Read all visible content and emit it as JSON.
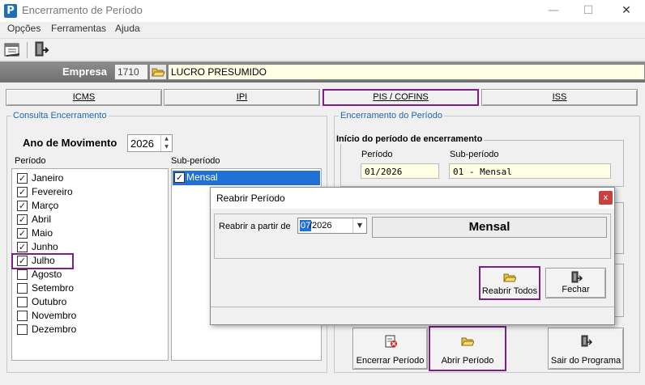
{
  "window": {
    "title": "Encerramento de Período",
    "icon_letter": "P",
    "controls": {
      "minimize": "—",
      "maximize": "☐",
      "close": "✕"
    }
  },
  "menu": [
    "Opções",
    "Ferramentas",
    "Ajuda"
  ],
  "toolbar": {
    "icons": [
      "calendar-icon",
      "exit-icon"
    ]
  },
  "empresa": {
    "label": "Empresa",
    "code": "1710",
    "name": "LUCRO PRESUMIDO"
  },
  "tabs": [
    {
      "label": "ICMS",
      "active": false
    },
    {
      "label": "IPI",
      "active": false
    },
    {
      "label": "PIS / COFINS",
      "active": true
    },
    {
      "label": "ISS",
      "active": false
    }
  ],
  "consulta": {
    "group_title": "Consulta Encerramento",
    "ano_label": "Ano de Movimento",
    "ano": "2026",
    "periodo_label": "Período",
    "subperiodo_label": "Sub-período",
    "months": [
      {
        "label": "Janeiro",
        "checked": true
      },
      {
        "label": "Fevereiro",
        "checked": true
      },
      {
        "label": "Março",
        "checked": true
      },
      {
        "label": "Abril",
        "checked": true
      },
      {
        "label": "Maio",
        "checked": true
      },
      {
        "label": "Junho",
        "checked": true
      },
      {
        "label": "Julho",
        "checked": true
      },
      {
        "label": "Agosto",
        "checked": false
      },
      {
        "label": "Setembro",
        "checked": false
      },
      {
        "label": "Outubro",
        "checked": false
      },
      {
        "label": "Novembro",
        "checked": false
      },
      {
        "label": "Dezembro",
        "checked": false
      }
    ],
    "subperiodos": [
      {
        "label": "Mensal",
        "checked": true
      }
    ]
  },
  "encerramento": {
    "group_title": "Encerramento do Período",
    "inicio_title": "Início do período de encerramento",
    "periodo_label": "Período",
    "periodo_value": "01/2026",
    "subperiodo_label": "Sub-período",
    "subperiodo_value": "01 - Mensal",
    "buttons": {
      "encerrar": "Encerrar Período",
      "abrir": "Abrir Período",
      "sair": "Sair do Programa"
    }
  },
  "dialog": {
    "title": "Reabrir Período",
    "close": "x",
    "reabrir_label": "Reabrir a partir de",
    "month_selected": "07",
    "date_rest": "/2026",
    "subperiod": "Mensal",
    "reabrir_todos": "Reabrir Todos",
    "fechar": "Fechar"
  }
}
